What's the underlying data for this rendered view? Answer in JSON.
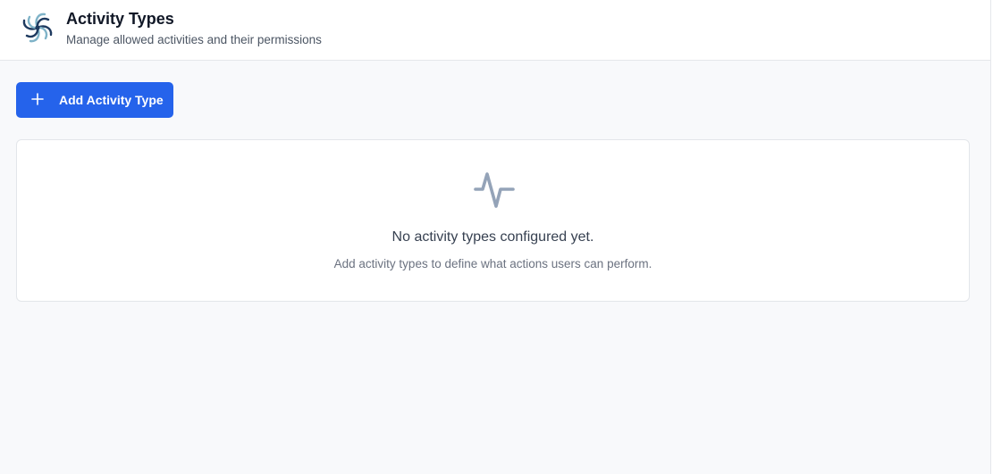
{
  "header": {
    "title": "Activity Types",
    "subtitle": "Manage allowed activities and their permissions",
    "logo_icon": "spiral-flower-logo"
  },
  "toolbar": {
    "add_label": "Add Activity Type",
    "add_icon": "plus-icon"
  },
  "empty_state": {
    "icon": "activity-pulse-icon",
    "title": "No activity types configured yet.",
    "description": "Add activity types to define what actions users can perform."
  },
  "colors": {
    "accent": "#2563eb",
    "background": "#f8f9fb",
    "card": "#ffffff",
    "muted_icon": "#94a3b8",
    "logo_dark": "#1e3a5f",
    "logo_light": "#7fb3c8"
  }
}
